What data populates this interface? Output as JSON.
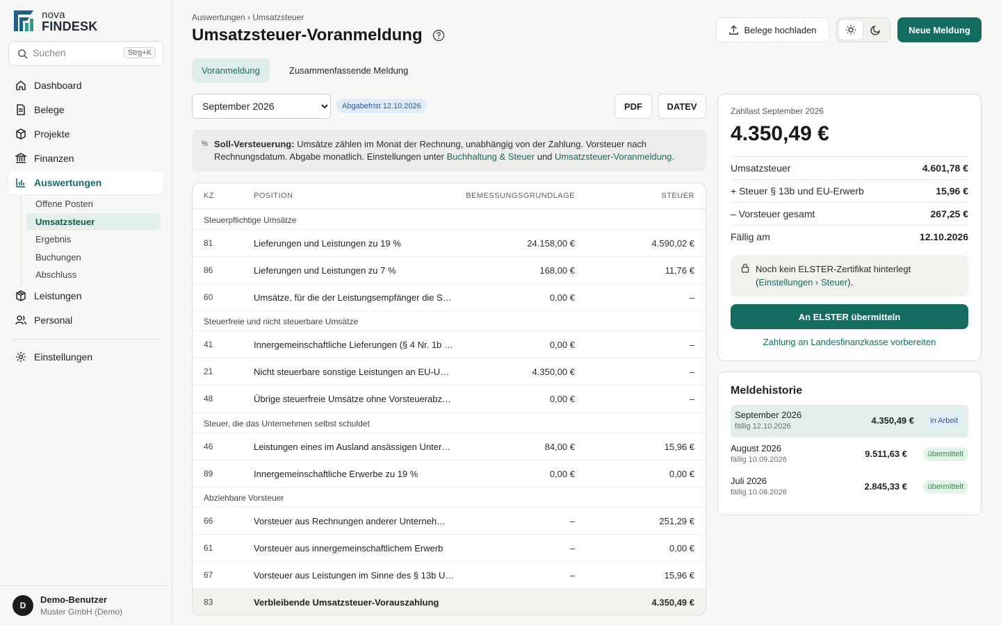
{
  "brand": {
    "small": "nova",
    "big": "FINDESK",
    "accent": "#146b5f"
  },
  "search": {
    "placeholder": "Suchen",
    "shortcut": "Strg+K"
  },
  "sidebar": {
    "items": [
      {
        "label": "Dashboard",
        "icon": "home-icon"
      },
      {
        "label": "Belege",
        "icon": "document-icon"
      },
      {
        "label": "Projekte",
        "icon": "box-icon"
      },
      {
        "label": "Finanzen",
        "icon": "bank-icon"
      },
      {
        "label": "Auswertungen",
        "icon": "bar-chart-icon"
      },
      {
        "label": "Leistungen",
        "icon": "package-icon"
      },
      {
        "label": "Personal",
        "icon": "users-icon"
      },
      {
        "label": "Einstellungen",
        "icon": "gear-icon"
      }
    ],
    "sub": [
      "Offene Posten",
      "Umsatzsteuer",
      "Ergebnis",
      "Buchungen",
      "Abschluss"
    ]
  },
  "user": {
    "initial": "D",
    "name": "Demo-Benutzer",
    "org": "Muster GmbH (Demo)"
  },
  "header": {
    "breadcrumb": "Auswertungen › Umsatzsteuer",
    "title": "Umsatzsteuer-Voranmeldung",
    "upload_label": "Belege hochladen",
    "new_label": "Neue Meldung"
  },
  "tabs": [
    "Voranmeldung",
    "Zusammenfassende Meldung"
  ],
  "period": {
    "selected": "September 2026",
    "deadline": "Abgabefrist 12.10.2026"
  },
  "export": {
    "pdf": "PDF",
    "datev": "DATEV"
  },
  "info": {
    "icon": "%",
    "bold": "Soll-Versteuerung:",
    "text1": " Umsätze zählen im Monat der Rechnung, unabhängig von der Zahlung. Vorsteuer nach Rechnungsdatum. Abgabe monatlich. Einstellungen unter ",
    "link1": "Buchhaltung & Steuer",
    "and": " und ",
    "link2": "Umsatzsteuer-Voranmeldung",
    "end": "."
  },
  "table": {
    "headers": [
      "KZ",
      "POSITION",
      "BEMESSUNGSGRUNDLAGE",
      "STEUER"
    ],
    "groups": [
      "Steuerpflichtige Umsätze",
      "Steuerfreie und nicht steuerbare Umsätze",
      "Steuer, die das Unternehmen selbst schuldet",
      "Abziehbare Vorsteuer"
    ],
    "rows": [
      {
        "kz": "81",
        "pos": "Lieferungen und Leistungen zu 19 %",
        "base": "24.158,00 €",
        "tax": "4.590,02 €"
      },
      {
        "kz": "86",
        "pos": "Lieferungen und Leistungen zu 7 %",
        "base": "168,00 €",
        "tax": "11,76 €"
      },
      {
        "kz": "60",
        "pos": "Umsätze, für die der Leistungsempfänger die S…",
        "base": "0,00 €",
        "tax": "–"
      },
      {
        "kz": "41",
        "pos": "Innergemeinschaftliche Lieferungen (§ 4 Nr. 1b …",
        "base": "0,00 €",
        "tax": "–"
      },
      {
        "kz": "21",
        "pos": "Nicht steuerbare sonstige Leistungen an EU-U…",
        "base": "4.350,00 €",
        "tax": "–"
      },
      {
        "kz": "48",
        "pos": "Übrige steuerfreie Umsätze ohne Vorsteuerabz…",
        "base": "0,00 €",
        "tax": "–"
      },
      {
        "kz": "46",
        "pos": "Leistungen eines im Ausland ansässigen Unter…",
        "base": "84,00 €",
        "tax": "15,96 €"
      },
      {
        "kz": "89",
        "pos": "Innergemeinschaftliche Erwerbe zu 19 %",
        "base": "0,00 €",
        "tax": "0,00 €"
      },
      {
        "kz": "66",
        "pos": "Vorsteuer aus Rechnungen anderer Unterneh…",
        "base": "–",
        "tax": "251,29 €"
      },
      {
        "kz": "61",
        "pos": "Vorsteuer aus innergemeinschaftlichem Erwerb",
        "base": "–",
        "tax": "0,00 €"
      },
      {
        "kz": "67",
        "pos": "Vorsteuer aus Leistungen im Sinne des § 13b U…",
        "base": "–",
        "tax": "15,96 €"
      }
    ],
    "total": {
      "kz": "83",
      "pos": "Verbleibende Umsatzsteuer-Vorauszahlung",
      "tax": "4.350,49 €"
    }
  },
  "summary": {
    "label": "Zahllast September 2026",
    "value": "4.350,49 €",
    "lines": [
      {
        "k": "Umsatzsteuer",
        "v": "4.601,78 €"
      },
      {
        "k": "+ Steuer § 13b und EU-Erwerb",
        "v": "15,96 €"
      },
      {
        "k": "– Vorsteuer gesamt",
        "v": "267,25 €"
      },
      {
        "k": "Fällig am",
        "v": "12.10.2026"
      }
    ],
    "notice1": "Noch kein ELSTER-Zertifikat hinterlegt",
    "notice_open": "(",
    "notice_link": "Einstellungen › Steuer",
    "notice_close": ").",
    "elster_label": "An ELSTER übermitteln",
    "pay_label": "Zahlung an Landesfinanzkasse vorbereiten"
  },
  "history": {
    "title": "Meldehistorie",
    "items": [
      {
        "month": "September 2026",
        "due": "fällig 12.10.2026",
        "amount": "4.350,49 €",
        "status": "in Arbeit"
      },
      {
        "month": "August 2026",
        "due": "fällig 10.09.2026",
        "amount": "9.511,63 €",
        "status": "übermittelt"
      },
      {
        "month": "Juli 2026",
        "due": "fällig 10.08.2026",
        "amount": "2.845,33 €",
        "status": "übermittelt"
      }
    ]
  }
}
